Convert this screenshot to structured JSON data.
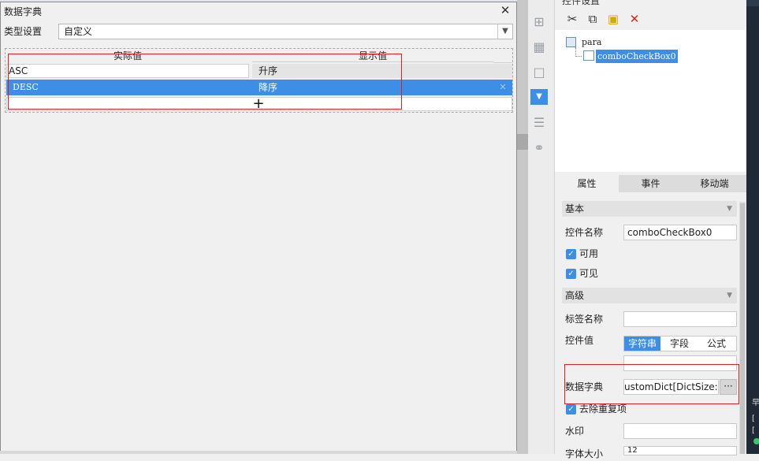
{
  "dialog": {
    "title": "数据字典",
    "close_glyph": "✕",
    "type_label": "类型设置",
    "type_value": "自定义",
    "columns": {
      "actual": "实际值",
      "display": "显示值"
    },
    "rows": [
      {
        "actual": "ASC",
        "display": "升序"
      },
      {
        "actual": "DESC",
        "display": "降序"
      }
    ],
    "delete_glyph": "✕",
    "add_glyph": "+"
  },
  "toolbar": {
    "icons": [
      "grid-icon",
      "table-icon",
      "rectangle-icon",
      "dropdown-icon",
      "list-icon",
      "link-icon"
    ]
  },
  "right_panel": {
    "title": "控件设置",
    "tree": {
      "root": "para",
      "child": "comboCheckBox0"
    },
    "tabs": [
      "属性",
      "事件",
      "移动端"
    ],
    "basic_section": "基本",
    "advanced_section": "高级",
    "control_name_label": "控件名称",
    "control_name_value": "comboCheckBox0",
    "enabled_label": "可用",
    "visible_label": "可见",
    "tag_name_label": "标签名称",
    "control_value_label": "控件值",
    "value_types": [
      "字符串",
      "字段",
      "公式"
    ],
    "dict_label": "数据字典",
    "dict_value": "ustomDict[DictSize:2]",
    "dict_button": "···",
    "dedupe_label": "去除重复项",
    "watermark_label": "水印",
    "font_size_label": "字体大小",
    "font_size_value": "12"
  },
  "edge_chars": [
    "早",
    "[",
    "["
  ]
}
